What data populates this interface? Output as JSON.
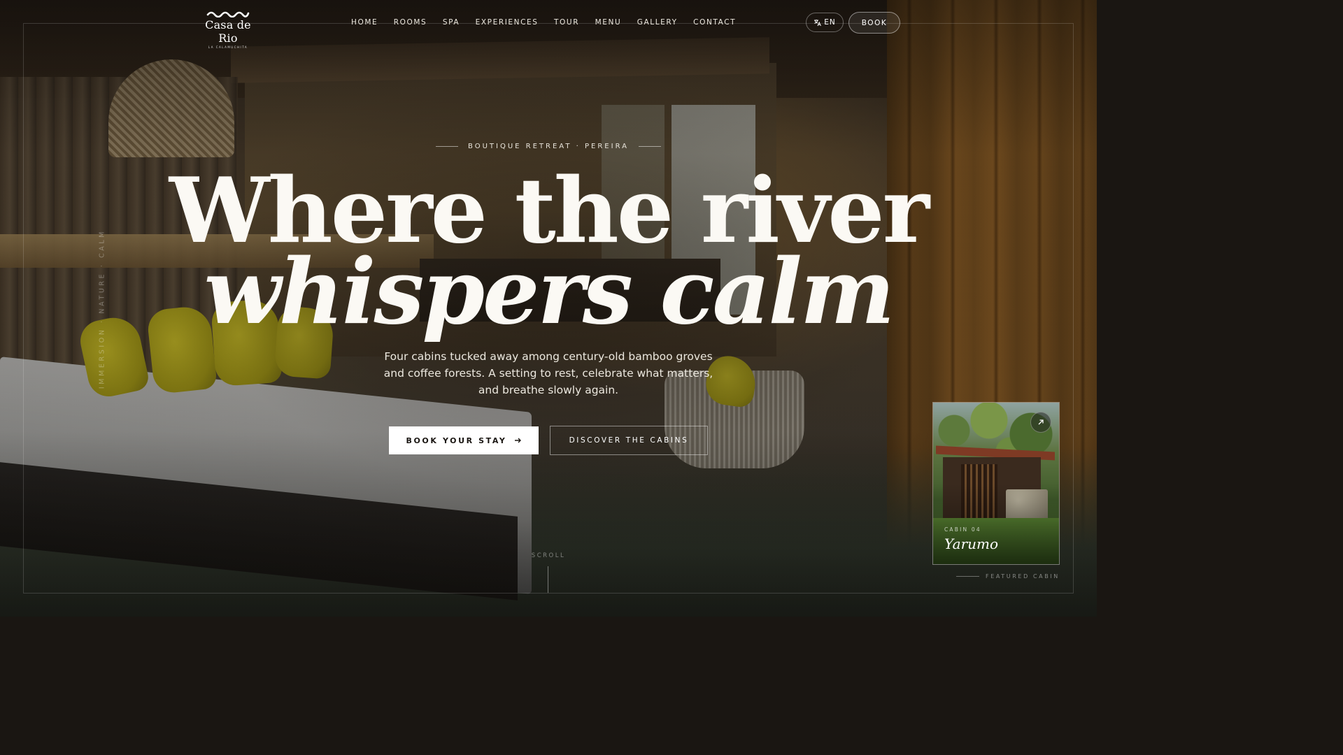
{
  "brand": {
    "name": "Casa de Rio",
    "tagline": "LA CALAMUCHITA"
  },
  "nav": {
    "items": [
      "HOME",
      "ROOMS",
      "SPA",
      "EXPERIENCES",
      "TOUR",
      "MENU",
      "GALLERY",
      "CONTACT"
    ]
  },
  "header": {
    "language_label": "EN",
    "language_icon": "translate-icon",
    "book_label": "BOOK"
  },
  "side_text": "IMMERSION · NATURE · CALM",
  "hero": {
    "eyebrow": "BOUTIQUE RETREAT · PEREIRA",
    "headline_line1": "Where the river",
    "headline_line2": "whispers calm",
    "subcopy": "Four cabins tucked away among century-old bamboo groves and coffee forests. A setting to rest, celebrate what matters, and breathe slowly again.",
    "cta_primary": "BOOK YOUR STAY",
    "cta_primary_icon": "arrow-right-icon",
    "cta_secondary": "DISCOVER THE CABINS",
    "scroll_label": "SCROLL"
  },
  "featured": {
    "kicker": "CABIN 04",
    "title": "Yarumo",
    "label": "FEATURED CABIN",
    "link_icon": "arrow-up-right-icon"
  },
  "colors": {
    "text": "#f2efe8",
    "cta_bg": "#ffffff",
    "cta_text": "#1a1612",
    "frame": "rgba(255,255,255,0.16)"
  }
}
